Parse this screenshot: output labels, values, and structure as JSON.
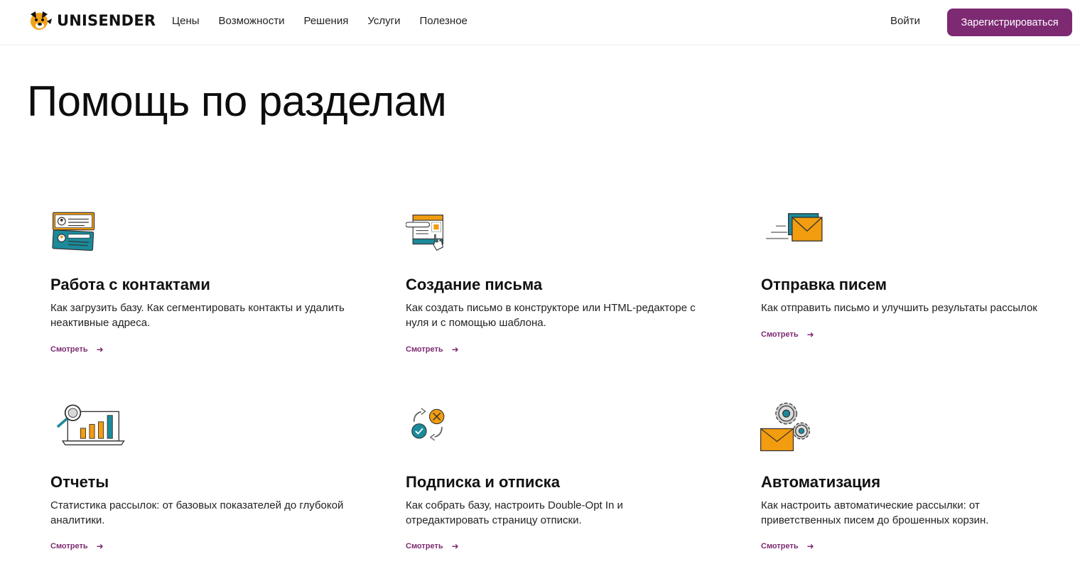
{
  "header": {
    "logo_text": "UNISENDER",
    "nav": [
      "Цены",
      "Возможности",
      "Решения",
      "Услуги",
      "Полезное"
    ],
    "login_label": "Войти",
    "register_label": "Зарегистрироваться"
  },
  "page": {
    "title": "Помощь по разделам"
  },
  "cards": [
    {
      "title": "Работа с контактами",
      "description": "Как загрузить базу. Как сегментировать контакты и удалить неактивные адреса.",
      "link": "Смотреть",
      "icon": "contacts-icon"
    },
    {
      "title": "Создание письма",
      "description": "Как создать письмо в конструкторе или HTML-редакторе с нуля и с помощью шаблона.",
      "link": "Смотреть",
      "icon": "email-builder-icon"
    },
    {
      "title": "Отправка писем",
      "description": "Как отправить письмо и улучшить результаты рассылок",
      "link": "Смотреть",
      "icon": "send-email-icon"
    },
    {
      "title": "Отчеты",
      "description": "Статистика рассылок: от базовых показателей до глубокой аналитики.",
      "link": "Смотреть",
      "icon": "reports-icon"
    },
    {
      "title": "Подписка и отписка",
      "description": "Как собрать базу, настроить Double-Opt In и отредактировать страницу отписки.",
      "link": "Смотреть",
      "icon": "subscription-icon"
    },
    {
      "title": "Автоматизация",
      "description": "Как настроить автоматические рассылки: от приветственных писем до брошенных корзин.",
      "link": "Смотреть",
      "icon": "automation-icon"
    }
  ],
  "colors": {
    "accent": "#7d2a73",
    "orange": "#f29c0f",
    "teal": "#1b8a9a"
  }
}
